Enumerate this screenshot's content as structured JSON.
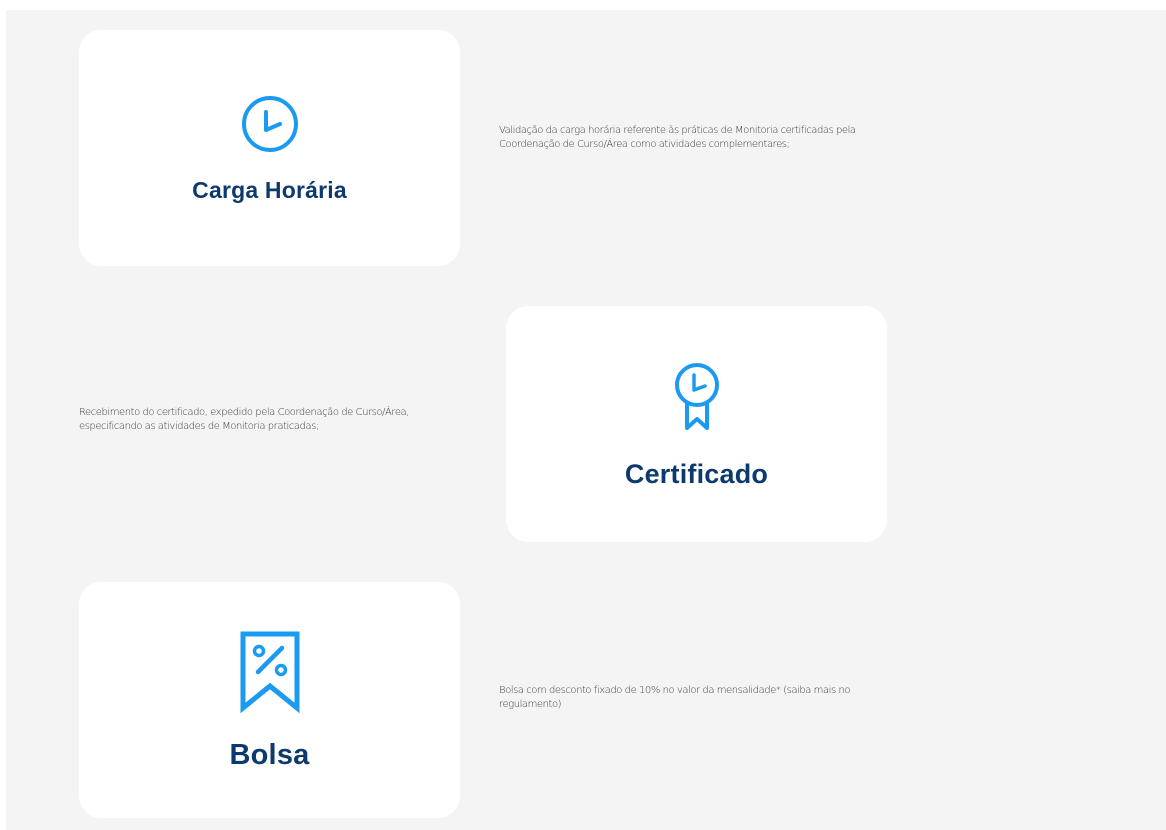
{
  "colors": {
    "background": "#f4f4f4",
    "card": "#ffffff",
    "icon_blue": "#1a9af0",
    "title_navy": "#0d3a6e",
    "text": "#3a3a3a"
  },
  "benefits": [
    {
      "icon": "clock-icon",
      "title": "Carga Horária",
      "description": "Validação da carga horária referente às práticas de Monitoria certificadas pela Coordenação de Curso/Área como atividades complementares;"
    },
    {
      "icon": "award-ribbon-icon",
      "title": "Certificado",
      "description": "Recebimento do certificado, expedido pela Coordenação de Curso/Área, especificando as atividades de Monitoria praticadas;"
    },
    {
      "icon": "discount-bookmark-icon",
      "title": "Bolsa",
      "description": "Bolsa com desconto fixado de 10% no valor da mensalidade* (saiba mais no regulamento)"
    }
  ]
}
